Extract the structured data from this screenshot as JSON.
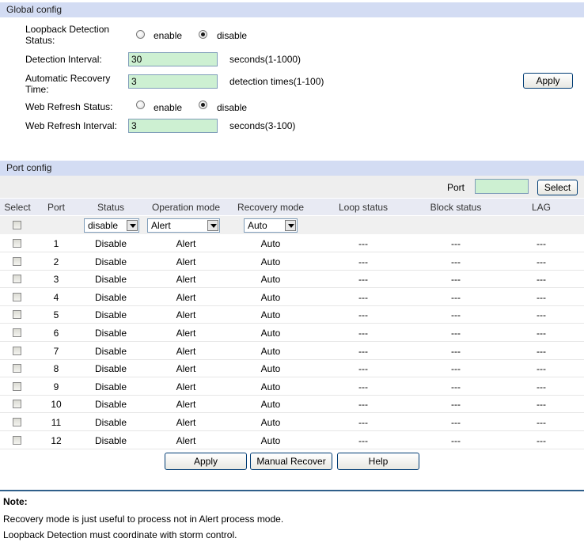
{
  "global": {
    "header": "Global config",
    "loopback_label_1": "Loopback Detection",
    "loopback_label_2": "Status:",
    "enable_label": "enable",
    "disable_label": "disable",
    "loopback_selected": "disable",
    "interval_label": "Detection Interval:",
    "interval_value": "30",
    "interval_hint": "seconds(1-1000)",
    "recovery_label_1": "Automatic Recovery",
    "recovery_label_2": "Time:",
    "recovery_value": "3",
    "recovery_hint": "detection times(1-100)",
    "apply_label": "Apply",
    "web_refresh_label": "Web Refresh Status:",
    "web_refresh_selected": "disable",
    "web_interval_label": "Web Refresh Interval:",
    "web_interval_value": "3",
    "web_interval_hint": "seconds(3-100)"
  },
  "port": {
    "header": "Port config",
    "port_label": "Port",
    "port_input_value": "",
    "select_button": "Select",
    "columns": [
      "Select",
      "Port",
      "Status",
      "Operation mode",
      "Recovery mode",
      "Loop status",
      "Block status",
      "LAG"
    ],
    "filter_status": "disable",
    "filter_operation": "Alert",
    "filter_recovery": "Auto",
    "rows": [
      {
        "port": "1",
        "status": "Disable",
        "operation": "Alert",
        "recovery": "Auto",
        "loop": "---",
        "block": "---",
        "lag": "---"
      },
      {
        "port": "2",
        "status": "Disable",
        "operation": "Alert",
        "recovery": "Auto",
        "loop": "---",
        "block": "---",
        "lag": "---"
      },
      {
        "port": "3",
        "status": "Disable",
        "operation": "Alert",
        "recovery": "Auto",
        "loop": "---",
        "block": "---",
        "lag": "---"
      },
      {
        "port": "4",
        "status": "Disable",
        "operation": "Alert",
        "recovery": "Auto",
        "loop": "---",
        "block": "---",
        "lag": "---"
      },
      {
        "port": "5",
        "status": "Disable",
        "operation": "Alert",
        "recovery": "Auto",
        "loop": "---",
        "block": "---",
        "lag": "---"
      },
      {
        "port": "6",
        "status": "Disable",
        "operation": "Alert",
        "recovery": "Auto",
        "loop": "---",
        "block": "---",
        "lag": "---"
      },
      {
        "port": "7",
        "status": "Disable",
        "operation": "Alert",
        "recovery": "Auto",
        "loop": "---",
        "block": "---",
        "lag": "---"
      },
      {
        "port": "8",
        "status": "Disable",
        "operation": "Alert",
        "recovery": "Auto",
        "loop": "---",
        "block": "---",
        "lag": "---"
      },
      {
        "port": "9",
        "status": "Disable",
        "operation": "Alert",
        "recovery": "Auto",
        "loop": "---",
        "block": "---",
        "lag": "---"
      },
      {
        "port": "10",
        "status": "Disable",
        "operation": "Alert",
        "recovery": "Auto",
        "loop": "---",
        "block": "---",
        "lag": "---"
      },
      {
        "port": "11",
        "status": "Disable",
        "operation": "Alert",
        "recovery": "Auto",
        "loop": "---",
        "block": "---",
        "lag": "---"
      },
      {
        "port": "12",
        "status": "Disable",
        "operation": "Alert",
        "recovery": "Auto",
        "loop": "---",
        "block": "---",
        "lag": "---"
      }
    ]
  },
  "buttons": {
    "apply": "Apply",
    "manual_recover": "Manual Recover",
    "help": "Help"
  },
  "note": {
    "title": "Note:",
    "line1": "Recovery mode is just useful to process not in Alert process mode.",
    "line2": "Loopback Detection must coordinate with storm control."
  },
  "colors": {
    "header_bg": "#d3dcf3",
    "input_bg": "#cdf0d2",
    "table_header_bg": "#e8eaf3"
  }
}
